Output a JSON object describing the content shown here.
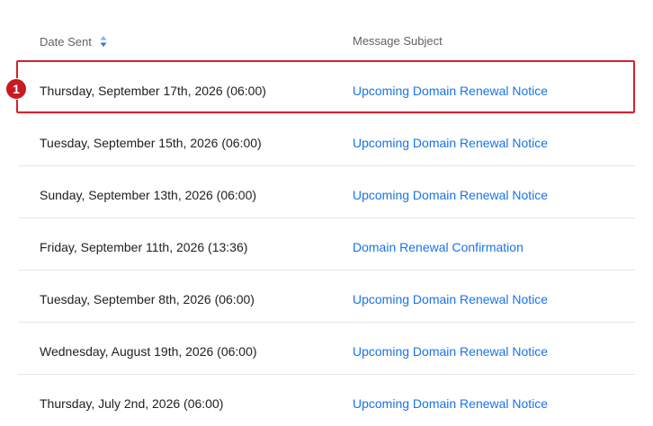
{
  "table": {
    "headers": {
      "date_sent": "Date Sent",
      "message_subject": "Message Subject",
      "sort_icon": "sort-icon"
    },
    "rows": [
      {
        "date": "Thursday, September 17th, 2026 (06:00)",
        "subject": "Upcoming Domain Renewal Notice"
      },
      {
        "date": "Tuesday, September 15th, 2026 (06:00)",
        "subject": "Upcoming Domain Renewal Notice"
      },
      {
        "date": "Sunday, September 13th, 2026 (06:00)",
        "subject": "Upcoming Domain Renewal Notice"
      },
      {
        "date": "Friday, September 11th, 2026 (13:36)",
        "subject": "Domain Renewal Confirmation"
      },
      {
        "date": "Tuesday, September 8th, 2026 (06:00)",
        "subject": "Upcoming Domain Renewal Notice"
      },
      {
        "date": "Wednesday, August 19th, 2026 (06:00)",
        "subject": "Upcoming Domain Renewal Notice"
      },
      {
        "date": "Thursday, July 2nd, 2026 (06:00)",
        "subject": "Upcoming Domain Renewal Notice"
      }
    ]
  },
  "annotation": {
    "badge_label": "1",
    "highlight_color": "#d9212c",
    "badge_color": "#c81a24"
  },
  "colors": {
    "link": "#1a73e8",
    "text": "#202124",
    "header_text": "#5f6368",
    "sort_icon": "#4a7fd6"
  }
}
